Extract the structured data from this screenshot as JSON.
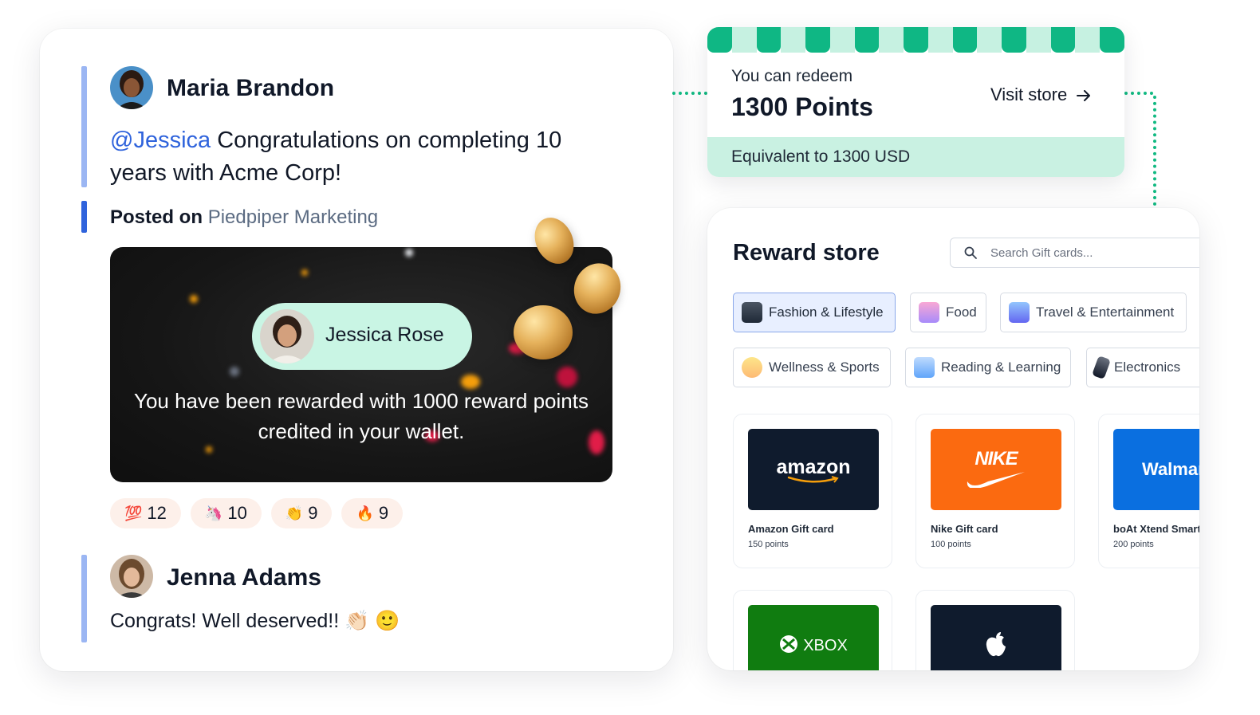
{
  "feed": {
    "post": {
      "author": "Maria Brandon",
      "mention": "@Jessica",
      "message": " Congratulations on completing 10 years with Acme Corp!",
      "posted_on_label": "Posted on",
      "team": "Piedpiper Marketing"
    },
    "reward": {
      "recipient": "Jessica Rose",
      "message": "You have been rewarded with 1000 reward points credited in your wallet."
    },
    "reactions": [
      {
        "emoji": "💯",
        "icon": "hundred-points-icon",
        "count": "12"
      },
      {
        "emoji": "🦄",
        "icon": "unicorn-icon",
        "count": "10"
      },
      {
        "emoji": "👏",
        "icon": "clapping-hands-icon",
        "count": "9"
      },
      {
        "emoji": "🔥",
        "icon": "fire-icon",
        "count": "9"
      }
    ],
    "reply": {
      "author": "Jenna Adams",
      "message": "Congrats! Well deserved!! 👏🏻 🙂"
    }
  },
  "redeem": {
    "label": "You can redeem",
    "points": "1300 Points",
    "visit_store": "Visit store",
    "equivalent": "Equivalent to 1300 USD",
    "accent_color": "#0fb784"
  },
  "store": {
    "title": "Reward store",
    "search_placeholder": "Search Gift cards...",
    "categories": [
      {
        "label": "Fashion & Lifestyle",
        "active": true
      },
      {
        "label": "Food"
      },
      {
        "label": "Travel & Entertainment"
      },
      {
        "label": "Wellness & Sports"
      },
      {
        "label": "Reading & Learning"
      },
      {
        "label": "Electronics"
      }
    ],
    "gift_cards": [
      {
        "brand": "amazon",
        "name": "Amazon Gift card",
        "points": "150 points"
      },
      {
        "brand": "NIKE",
        "name": "Nike Gift card",
        "points": "100 points"
      },
      {
        "brand": "Walmart",
        "name": "boAt Xtend Smart",
        "points": "200 points"
      },
      {
        "brand": "XBOX",
        "name": "",
        "points": ""
      },
      {
        "brand": "apple",
        "name": "",
        "points": ""
      }
    ]
  }
}
